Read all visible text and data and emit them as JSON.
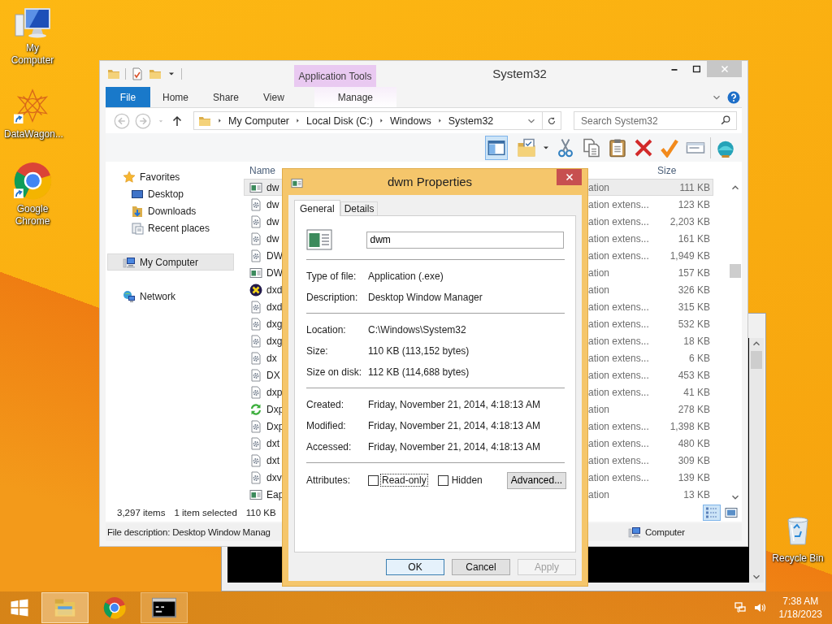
{
  "desktop_icons": [
    {
      "label": "My Computer",
      "kind": "computer",
      "shortcut": false
    },
    {
      "label": "DataWagon...",
      "kind": "datawagon",
      "shortcut": true
    },
    {
      "label": "Google Chrome",
      "kind": "chrome",
      "shortcut": true
    }
  ],
  "recycle_bin": {
    "label": "Recycle Bin"
  },
  "explorer": {
    "title": "System32",
    "contextual_group": "Application Tools",
    "tabs": [
      {
        "label": "File",
        "kind": "file",
        "selected": false
      },
      {
        "label": "Home",
        "kind": "plain",
        "selected": false
      },
      {
        "label": "Share",
        "kind": "plain",
        "selected": false
      },
      {
        "label": "View",
        "kind": "plain",
        "selected": false
      },
      {
        "label": "Manage",
        "kind": "contextual",
        "selected": false
      }
    ],
    "crumbs": [
      "My Computer",
      "Local Disk (C:)",
      "Windows",
      "System32"
    ],
    "search": {
      "placeholder": "Search System32"
    },
    "preview_pane": {
      "on": true
    },
    "toolbar": [
      {
        "kind": "folder-check"
      },
      {
        "kind": "cut"
      },
      {
        "kind": "copy"
      },
      {
        "kind": "paste"
      },
      {
        "kind": "delete"
      },
      {
        "kind": "check"
      },
      {
        "kind": "rename"
      },
      {
        "kind": "shell"
      }
    ],
    "nav": [
      {
        "label": "Favorites",
        "kind": "star",
        "selected": false,
        "children": [
          {
            "label": "Desktop",
            "kind": "desktop",
            "selected": false
          },
          {
            "label": "Downloads",
            "kind": "downloads",
            "selected": false
          },
          {
            "label": "Recent places",
            "kind": "recent",
            "selected": false
          }
        ]
      },
      {
        "label": "My Computer",
        "kind": "computer",
        "selected": true
      },
      {
        "label": "Network",
        "kind": "network",
        "selected": false
      }
    ],
    "columns": {
      "name": "Name",
      "size": "Size"
    },
    "rows": [
      {
        "kind": "app",
        "name": "dw",
        "type": "ation",
        "size": "111 KB",
        "selected": true
      },
      {
        "kind": "dll",
        "name": "dw",
        "type": "ation extens...",
        "size": "123 KB",
        "selected": false
      },
      {
        "kind": "dll",
        "name": "dw",
        "type": "ation extens...",
        "size": "2,203 KB",
        "selected": false
      },
      {
        "kind": "dll",
        "name": "dw",
        "type": "ation extens...",
        "size": "161 KB",
        "selected": false
      },
      {
        "kind": "dll",
        "name": "DW",
        "type": "ation extens...",
        "size": "1,949 KB",
        "selected": false
      },
      {
        "kind": "app",
        "name": "DW",
        "type": "ation",
        "size": "157 KB",
        "selected": false
      },
      {
        "kind": "directx",
        "name": "dxd",
        "type": "ation",
        "size": "326 KB",
        "selected": false
      },
      {
        "kind": "dll",
        "name": "dxd",
        "type": "ation extens...",
        "size": "315 KB",
        "selected": false
      },
      {
        "kind": "dll",
        "name": "dxg",
        "type": "ation extens...",
        "size": "532 KB",
        "selected": false
      },
      {
        "kind": "dll",
        "name": "dxg",
        "type": "ation extens...",
        "size": "18 KB",
        "selected": false
      },
      {
        "kind": "dll",
        "name": "dx",
        "type": "ation extens...",
        "size": "6 KB",
        "selected": false
      },
      {
        "kind": "dll",
        "name": "DX",
        "type": "ation extens...",
        "size": "453 KB",
        "selected": false
      },
      {
        "kind": "dll",
        "name": "dxp",
        "type": "ation extens...",
        "size": "41 KB",
        "selected": false
      },
      {
        "kind": "sync",
        "name": "Dxp",
        "type": "ation",
        "size": "278 KB",
        "selected": false
      },
      {
        "kind": "dll",
        "name": "Dxp",
        "type": "ation extens...",
        "size": "1,398 KB",
        "selected": false
      },
      {
        "kind": "dll",
        "name": "dxt",
        "type": "ation extens...",
        "size": "480 KB",
        "selected": false
      },
      {
        "kind": "dll",
        "name": "dxt",
        "type": "ation extens...",
        "size": "309 KB",
        "selected": false
      },
      {
        "kind": "dll",
        "name": "dxv",
        "type": "ation extens...",
        "size": "139 KB",
        "selected": false
      },
      {
        "kind": "app",
        "name": "Eap",
        "type": "ation",
        "size": "13 KB",
        "selected": false
      }
    ],
    "status": {
      "count": "3,297 items",
      "selection": "1 item selected",
      "size": "110 KB"
    },
    "views": [
      {
        "kind": "details",
        "selected": true
      },
      {
        "kind": "tiles",
        "selected": false
      }
    ],
    "details_bar": {
      "description": "File description: Desktop Window Manag",
      "location": "Computer"
    }
  },
  "dialog": {
    "title": "dwm Properties",
    "tabs": [
      {
        "label": "General",
        "selected": true
      },
      {
        "label": "Details",
        "selected": false
      }
    ],
    "file_name": "dwm",
    "groups": [
      [
        {
          "label": "Type of file:",
          "value": "Application (.exe)"
        },
        {
          "label": "Description:",
          "value": "Desktop Window Manager"
        }
      ],
      [
        {
          "label": "Location:",
          "value": "C:\\Windows\\System32"
        },
        {
          "label": "Size:",
          "value": "110 KB (113,152 bytes)"
        },
        {
          "label": "Size on disk:",
          "value": "112 KB (114,688 bytes)"
        }
      ],
      [
        {
          "label": "Created:",
          "value": "Friday, November 21, 2014, 4:18:13 AM"
        },
        {
          "label": "Modified:",
          "value": "Friday, November 21, 2014, 4:18:13 AM"
        },
        {
          "label": "Accessed:",
          "value": "Friday, November 21, 2014, 4:18:13 AM"
        }
      ]
    ],
    "attributes": {
      "label": "Attributes:",
      "options": [
        {
          "label": "Read-only",
          "checked": false,
          "focused": true
        },
        {
          "label": "Hidden",
          "checked": false,
          "focused": false
        }
      ],
      "advanced": "Advanced..."
    },
    "buttons": [
      {
        "label": "OK",
        "kind": "default",
        "disabled": false
      },
      {
        "label": "Cancel",
        "kind": "plain",
        "disabled": false
      },
      {
        "label": "Apply",
        "kind": "plain",
        "disabled": true
      }
    ]
  },
  "taskbar": {
    "apps": [
      {
        "kind": "explorer",
        "active": true,
        "running": true
      },
      {
        "kind": "chrome",
        "active": false,
        "running": false
      },
      {
        "kind": "console",
        "active": false,
        "running": true
      }
    ],
    "clock": {
      "time": "7:38 AM",
      "date": "1/18/2023"
    }
  }
}
